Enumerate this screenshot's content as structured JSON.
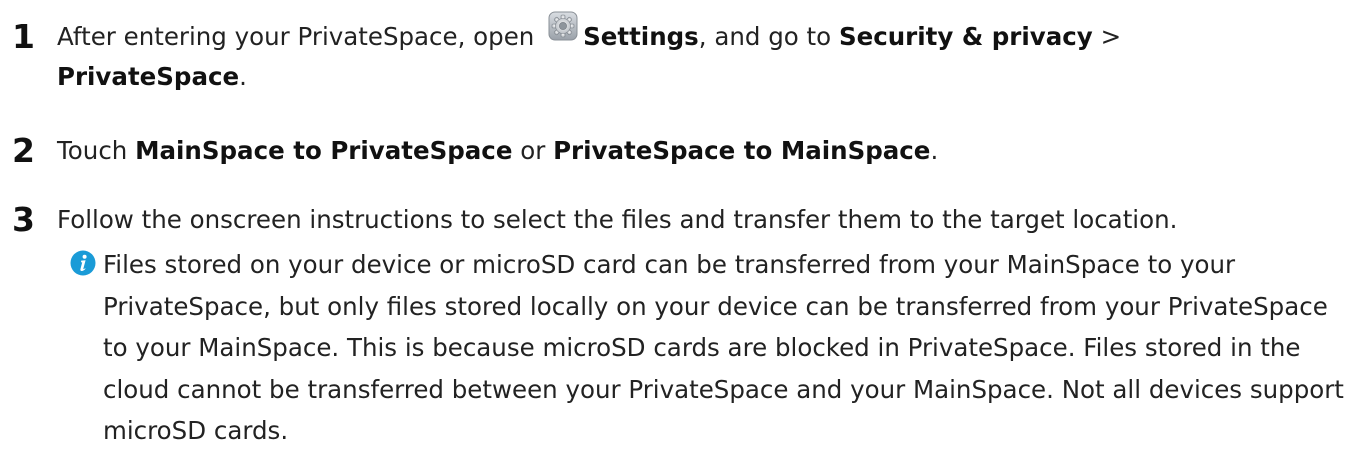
{
  "steps": [
    {
      "number": "1",
      "text_before_icon": "After entering your PrivateSpace, open ",
      "icon": "settings-gear-icon",
      "settings_label": "Settings",
      "text_mid": ", and go to ",
      "security_label": "Security & privacy",
      "separator": " > ",
      "privatespace_label": "PrivateSpace",
      "text_end": "."
    },
    {
      "number": "2",
      "text_before": "Touch ",
      "main_to_private": "MainSpace to PrivateSpace",
      "text_or": " or ",
      "private_to_main": "PrivateSpace to MainSpace",
      "text_end": "."
    },
    {
      "number": "3",
      "text": "Follow the onscreen instructions to select the files and transfer them to the target location."
    }
  ],
  "note": {
    "icon": "info-icon",
    "icon_color": "#1a9bd7",
    "text": "Files stored on your device or microSD card can be transferred from your MainSpace to your PrivateSpace, but only files stored locally on your device can be transferred from your PrivateSpace to your MainSpace. This is because microSD cards are blocked in PrivateSpace. Files stored in the cloud cannot be transferred between your PrivateSpace and your MainSpace. Not all devices support microSD cards."
  }
}
